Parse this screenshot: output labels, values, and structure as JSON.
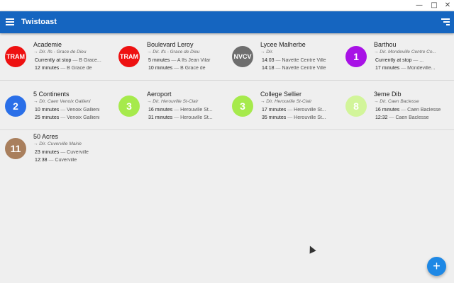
{
  "window": {
    "minimize": "—",
    "maximize": "□",
    "close": "✕"
  },
  "app": {
    "title": "Twistoast"
  },
  "stops": [
    {
      "badge": "TRAM",
      "color": "#ee1111",
      "name": "Academie",
      "dir": "→ Dir. Ifs - Grace de Dieu",
      "dep1_time": "Currently at stop",
      "dep1_dest": "B Grace...",
      "dep2_time": "12 minutes",
      "dep2_dest": "B Grace de"
    },
    {
      "badge": "TRAM",
      "color": "#ee1111",
      "name": "Boulevard Leroy",
      "dir": "→ Dir. Ifs - Grace de Dieu",
      "dep1_time": "5 minutes",
      "dep1_dest": "A  Ifs Jean Vilar",
      "dep2_time": "10 minutes",
      "dep2_dest": "B Grace de"
    },
    {
      "badge": "NVCV",
      "color": "#6e6e6e",
      "name": "Lycee Malherbe",
      "dir": "→ Dir.",
      "dep1_time": "14:03",
      "dep1_dest": "Navette Centre Ville",
      "dep2_time": "14:18",
      "dep2_dest": "Navette Centre Ville"
    },
    {
      "badge": "1",
      "color": "#a812e6",
      "name": "Barthou",
      "dir": "→ Dir. Mondeville Centre Co...",
      "dep1_time": "Currently at stop",
      "dep1_dest": "...",
      "dep2_time": "17 minutes",
      "dep2_dest": "Mondeville..."
    },
    {
      "badge": "2",
      "color": "#2a6fe8",
      "name": "5 Continents",
      "dir": "→ Dir. Caen Venoix Gallieni",
      "dep1_time": "10 minutes",
      "dep1_dest": "Venoix Gallieni",
      "dep2_time": "25 minutes",
      "dep2_dest": "Venoix Gallieni"
    },
    {
      "badge": "3",
      "color": "#a6ea4c",
      "name": "Aeroport",
      "dir": "→ Dir. Herouville St-Clair",
      "dep1_time": "16 minutes",
      "dep1_dest": "Herouville St...",
      "dep2_time": "31 minutes",
      "dep2_dest": "Herouville St..."
    },
    {
      "badge": "3",
      "color": "#a6ea4c",
      "name": "College Sellier",
      "dir": "→ Dir. Herouville St-Clair",
      "dep1_time": "17 minutes",
      "dep1_dest": "Herouville St...",
      "dep2_time": "35 minutes",
      "dep2_dest": "Herouville St..."
    },
    {
      "badge": "8",
      "color": "#d2f59a",
      "name": "3eme Dib",
      "dir": "→ Dir. Caen Baclesse",
      "dep1_time": "16 minutes",
      "dep1_dest": "Caen Baclesse",
      "dep2_time": "12:32",
      "dep2_dest": "Caen Baclesse"
    },
    {
      "badge": "11",
      "color": "#a97f5d",
      "name": "50 Acres",
      "dir": "→ Dir. Cuverville Mairie",
      "dep1_time": "23 minutes",
      "dep1_dest": "Cuverville",
      "dep2_time": "12:38",
      "dep2_dest": "Cuverville"
    }
  ],
  "fab": {
    "label": "+"
  },
  "separator": "—"
}
